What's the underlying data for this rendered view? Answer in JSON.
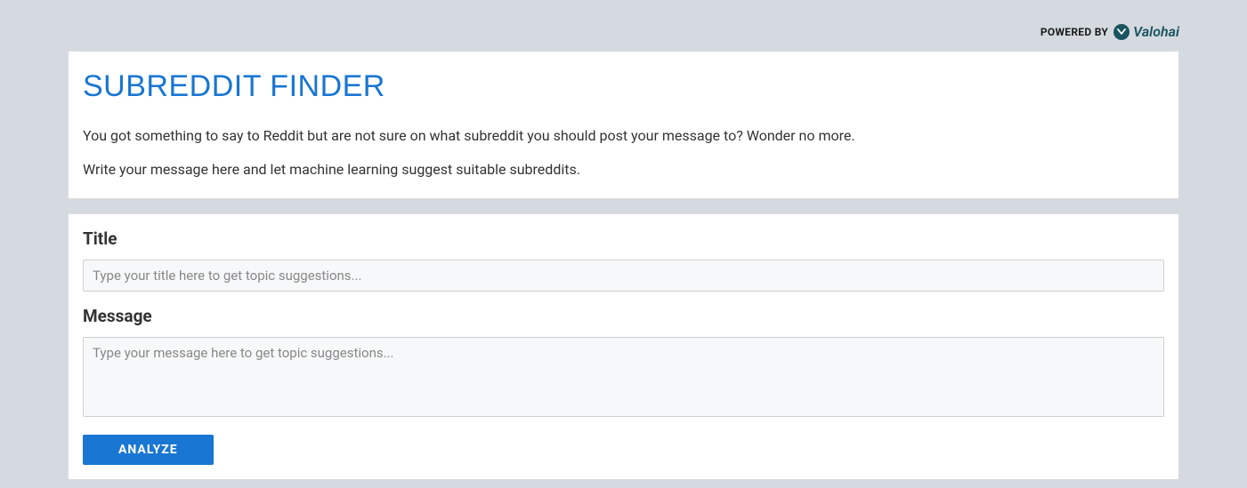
{
  "header": {
    "powered_by_label": "POWERED BY",
    "brand_name": "Valohai"
  },
  "intro": {
    "title": "SUBREDDIT FINDER",
    "description_1": "You got something to say to Reddit but are not sure on what subreddit you should post your message to? Wonder no more.",
    "description_2": "Write your message here and let machine learning suggest suitable subreddits."
  },
  "form": {
    "title_label": "Title",
    "title_placeholder": "Type your title here to get topic suggestions...",
    "message_label": "Message",
    "message_placeholder": "Type your message here to get topic suggestions...",
    "analyze_button_label": "ANALYZE"
  }
}
